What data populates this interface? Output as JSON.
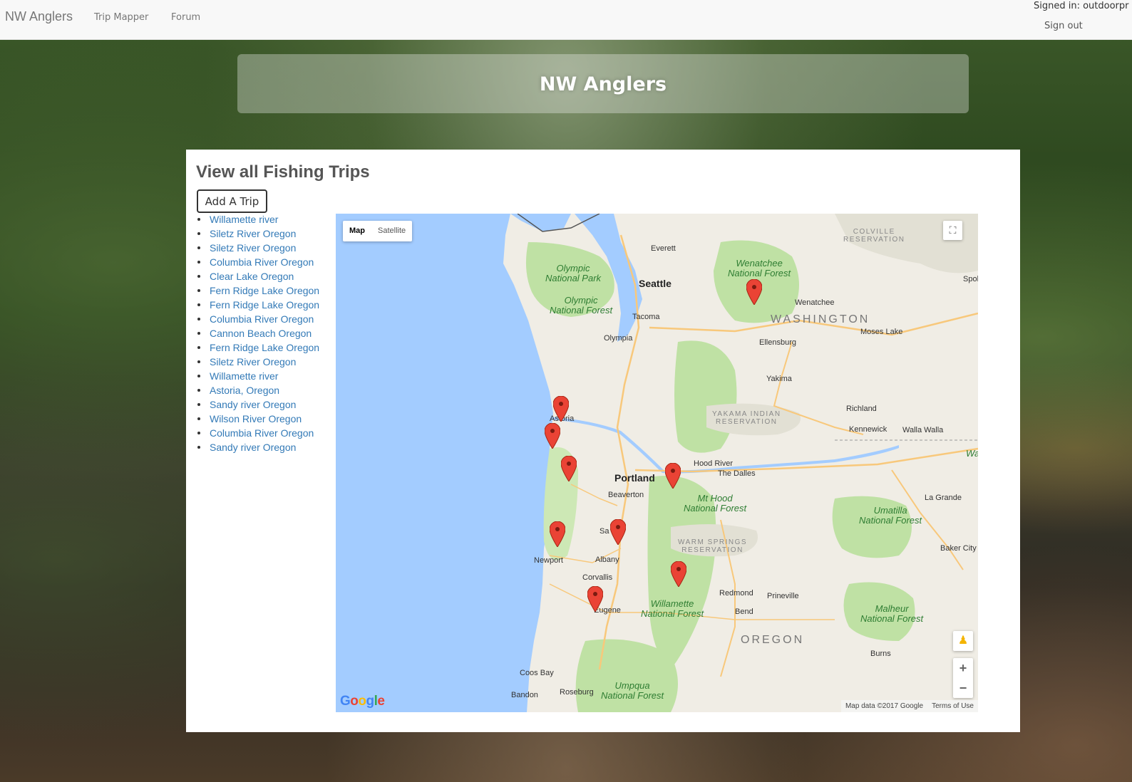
{
  "navbar": {
    "brand": "NW Anglers",
    "links": [
      "Trip Mapper",
      "Forum"
    ],
    "signed_in": "Signed in: outdoorpr",
    "sign_out": "Sign out"
  },
  "hero": {
    "title": "NW Anglers"
  },
  "panel": {
    "title": "View all Fishing Trips",
    "add_button": "Add A Trip",
    "trips": [
      "Willamette river",
      "Siletz River Oregon",
      "Siletz River Oregon",
      "Columbia River Oregon",
      "Clear Lake Oregon",
      "Fern Ridge Lake Oregon",
      "Fern Ridge Lake Oregon",
      "Columbia River Oregon",
      "Cannon Beach Oregon",
      "Fern Ridge Lake Oregon",
      "Siletz River Oregon",
      "Willamette river",
      "Astoria, Oregon",
      "Sandy river Oregon",
      "Wilson River Oregon",
      "Columbia River Oregon",
      "Sandy river Oregon"
    ]
  },
  "map": {
    "type_buttons": {
      "map": "Map",
      "satellite": "Satellite"
    },
    "zoom_in": "+",
    "zoom_out": "−",
    "logo": "Google",
    "attribution": "Map data ©2017 Google",
    "terms": "Terms of Use",
    "labels": {
      "seattle": "Seattle",
      "everett": "Everett",
      "tacoma": "Tacoma",
      "olympia": "Olympia",
      "portland": "Portland",
      "beaverton": "Beaverton",
      "salem": "Sa",
      "albany": "Albany",
      "corvallis": "Corvallis",
      "eugene": "Eugene",
      "newport": "Newport",
      "astoria": "Astoria",
      "coos_bay": "Coos Bay",
      "bandon": "Bandon",
      "roseburg": "Roseburg",
      "bend": "Bend",
      "redmond": "Redmond",
      "prineville": "Prineville",
      "hood_river": "Hood River",
      "the_dalles": "The Dalles",
      "yakima": "Yakima",
      "ellensburg": "Ellensburg",
      "wenatchee": "Wenatchee",
      "moses_lake": "Moses Lake",
      "richland": "Richland",
      "kennewick": "Kennewick",
      "walla_walla": "Walla Walla",
      "la_grande": "La Grande",
      "baker_city": "Baker City",
      "burns": "Burns",
      "spokane": "Spol",
      "wa_edge": "Wa",
      "washington": "WASHINGTON",
      "oregon": "OREGON",
      "olympic_np": "Olympic\nNational Park",
      "olympic_nf": "Olympic\nNational Forest",
      "wenatchee_nf": "Wenatchee\nNational Forest",
      "mthood_nf": "Mt Hood\nNational Forest",
      "willamette_nf": "Willamette\nNational Forest",
      "umatilla_nf": "Umatilla\nNational Forest",
      "malheur_nf": "Malheur\nNational Forest",
      "umpqua_nf": "Umpqua\nNational Forest",
      "colville_res": "COLVILLE\nRESERVATION",
      "yakama_res": "YAKAMA INDIAN\nRESERVATION",
      "warmsprings_res": "WARM SPRINGS\nRESERVATION"
    }
  }
}
